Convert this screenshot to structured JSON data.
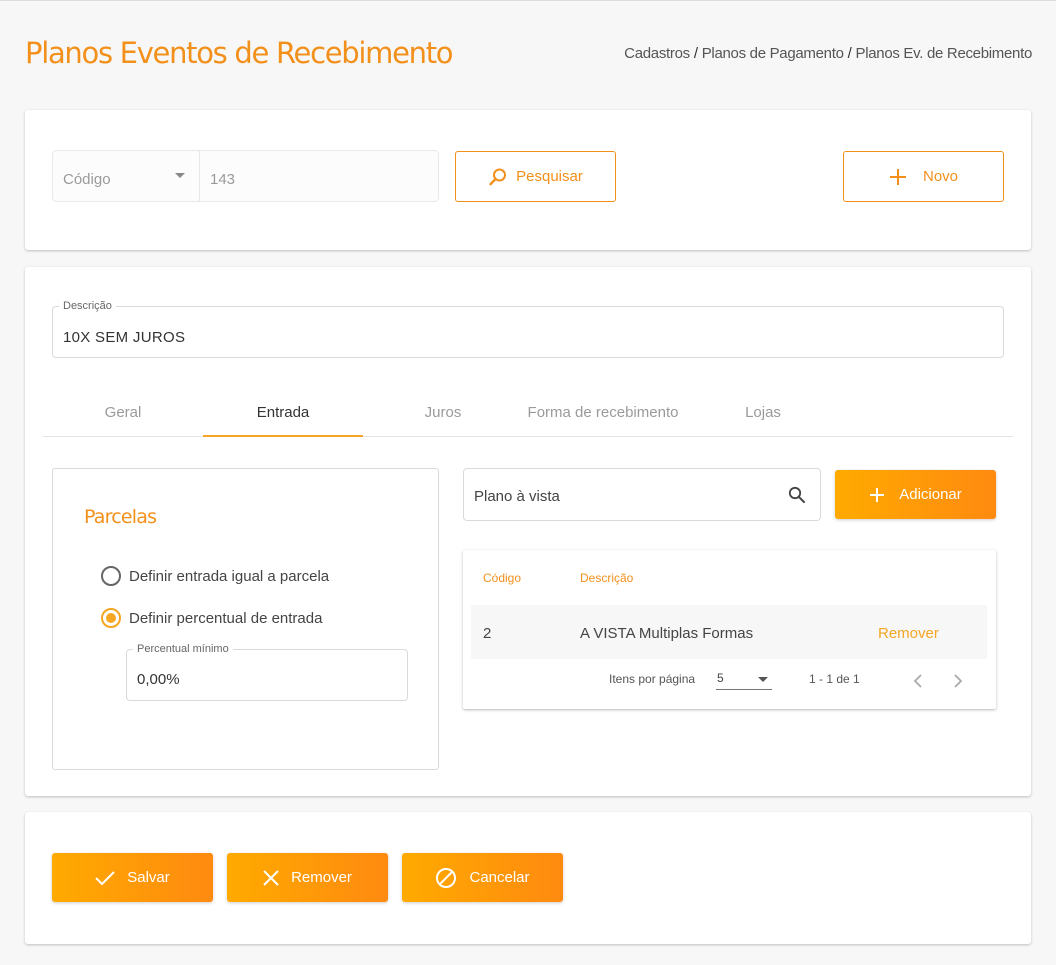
{
  "header": {
    "title": "Planos Eventos de Recebimento",
    "breadcrumb": [
      "Cadastros",
      "Planos de Pagamento",
      "Planos Ev. de Recebimento"
    ],
    "breadcrumb_separator": "/"
  },
  "search": {
    "field_selected": "Código",
    "value": "143",
    "search_label": "Pesquisar",
    "new_label": "Novo"
  },
  "form": {
    "description_label": "Descrição",
    "description_value": "10X SEM JUROS",
    "tabs": [
      {
        "label": "Geral",
        "active": false
      },
      {
        "label": "Entrada",
        "active": true
      },
      {
        "label": "Juros",
        "active": false
      },
      {
        "label": "Forma de recebimento",
        "active": false
      },
      {
        "label": "Lojas",
        "active": false
      }
    ]
  },
  "parcelas": {
    "title": "Parcelas",
    "options": [
      {
        "label": "Definir entrada igual a parcela",
        "checked": false
      },
      {
        "label": "Definir percentual de entrada",
        "checked": true
      }
    ],
    "percentual_label": "Percentual mínimo",
    "percentual_value": "0,00%"
  },
  "plans": {
    "search_value": "Plano à vista",
    "add_label": "Adicionar",
    "columns": [
      "Código",
      "Descrição"
    ],
    "rows": [
      {
        "code": "2",
        "description": "A VISTA Multiplas Formas",
        "action": "Remover"
      }
    ],
    "paginator": {
      "items_per_page_label": "Itens por página",
      "page_size": "5",
      "range": "1 - 1 de 1"
    }
  },
  "actions": {
    "save_label": "Salvar",
    "remove_label": "Remover",
    "cancel_label": "Cancelar"
  },
  "colors": {
    "accent": "#f3901b",
    "button_gradient_start": "#ffaa00",
    "button_gradient_end": "#ff8a10",
    "tab_indicator": "#f5a623"
  }
}
